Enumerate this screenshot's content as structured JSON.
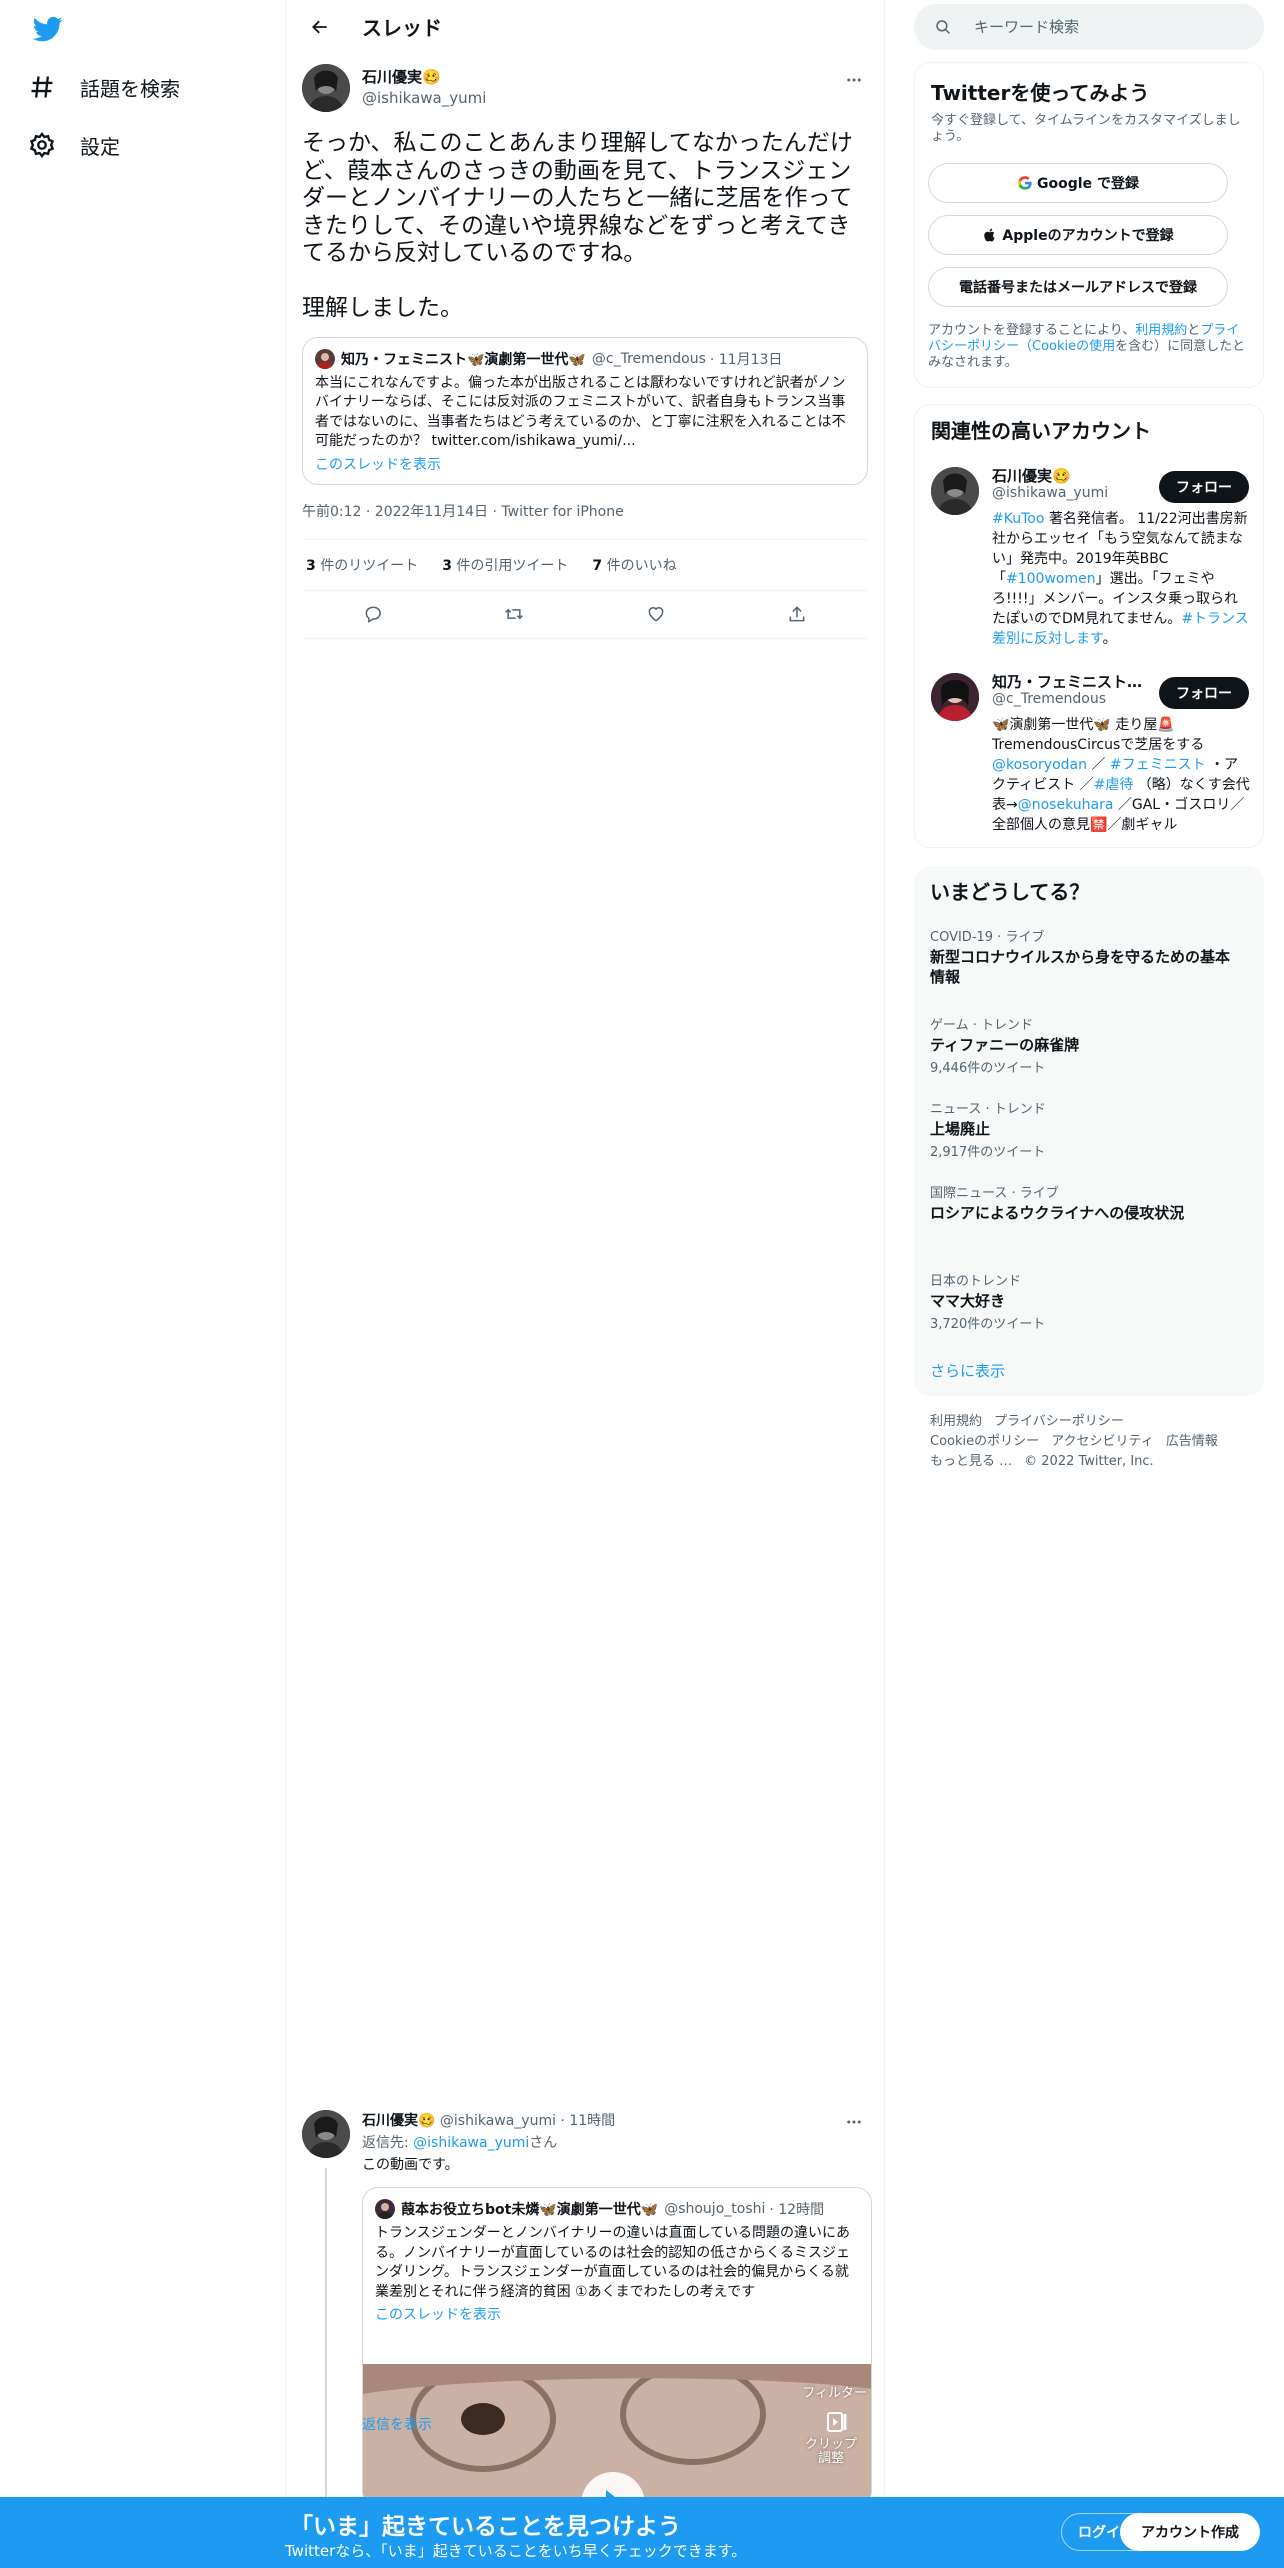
{
  "nav": {
    "explore_label": "話題を検索",
    "settings_label": "設定"
  },
  "header": {
    "title": "スレッド"
  },
  "main_tweet": {
    "author_name": "石川優実🥴",
    "author_handle": "@ishikawa_yumi",
    "text": "そっか、私このことあんまり理解してなかったんだけど、葭本さんのさっきの動画を見て、トランスジェンダーとノンバイナリーの人たちと一緒に芝居を作ってきたりして、その違いや境界線などをずっと考えてきてるから反対しているのですね。\n\n理解しました。",
    "quote": {
      "author_name": "知乃・フェミニスト🦋演劇第一世代🦋",
      "author_handle": "@c_Tremendous",
      "date": "· 11月13日",
      "text": "本当にこれなんですよ。偏った本が出版されることは厭わないですけれど訳者がノンバイナリーならば、そこには反対派のフェミニストがいて、訳者自身もトランス当事者ではないのに、当事者たちはどう考えているのか、と丁寧に注釈を入れることは不可能だったのか？ twitter.com/ishikawa_yumi/...",
      "show_thread": "このスレッドを表示"
    },
    "timestamp": "午前0:12 · 2022年11月14日 · Twitter for iPhone",
    "retweets_count": "3",
    "retweets_label": "件のリツイート",
    "quotes_count": "3",
    "quotes_label": "件の引用ツイート",
    "likes_count": "7",
    "likes_label": "件のいいね"
  },
  "reply_tweet": {
    "author_name": "石川優実🥴",
    "author_handle": "@ishikawa_yumi",
    "time": "· 11時間",
    "reply_to_prefix": "返信先:",
    "reply_to_handle": "@ishikawa_yumi",
    "reply_to_suffix": "さん",
    "text": "この動画です。",
    "quote": {
      "author_name": "葭本お役立ちbot未燐🦋演劇第一世代🦋",
      "author_handle": "@shoujo_toshi",
      "time": "· 12時間",
      "text": "トランスジェンダーとノンバイナリーの違いは直面している問題の違いにある。ノンバイナリーが直面しているのは社会的認知の低さからくるミスジェンダリング。トランスジェンダーが直面しているのは社会的偏見からくる就業差別とそれに伴う経済的貧困 ①あくまでわたしの考えです",
      "show_thread": "このスレッドを表示"
    },
    "video_filter_label": "フィルター",
    "video_clip_label": "クリップ調整",
    "show_replies": "返信を表示"
  },
  "search": {
    "placeholder": "キーワード検索"
  },
  "signup_panel": {
    "title": "Twitterを使ってみよう",
    "subtitle": "今すぐ登録して、タイムラインをカスタマイズしましょう。",
    "google_label": "Google で登録",
    "apple_label": "Appleのアカウントで登録",
    "phone_label": "電話番号またはメールアドレスで登録",
    "terms_prefix": "アカウントを登録することにより、",
    "terms_link": "利用規約",
    "terms_and": "と",
    "privacy_link": "プライバシーポリシー",
    "cookie_prefix": "（",
    "cookie_link": "Cookieの使用",
    "terms_suffix": "を含む）に同意したとみなされます。"
  },
  "relevant": {
    "title": "関連性の高いアカウント",
    "follow_label": "フォロー",
    "accounts": [
      {
        "name": "石川優実🥴",
        "handle": "@ishikawa_yumi",
        "bio_parts": [
          "#KuToo",
          " 著名発信者。 11/22河出書房新社からエッセイ「もう空気なんて読まない」発売中。2019年英BBC 「",
          "#100women",
          "」選出。「フェミやろ!!!!」メンバー。インスタ乗っ取られたぽいのでDM見れてません。",
          "#トランス差別に反対します",
          "。"
        ]
      },
      {
        "name": "知乃・フェミニスト…",
        "handle": "@c_Tremendous",
        "bio_parts": [
          "🦋演劇第一世代🦋 走り屋🚨TremendousCircusで芝居をする",
          "@kosoryodan",
          " ／ ",
          "#フェミニスト",
          " ・アクティビスト ／",
          "#虐待",
          " （略）なくす会代表→",
          "@nosekuhara",
          " ／GAL・ゴスロリ／全部個人の意見🈲／劇ギャル"
        ]
      }
    ]
  },
  "trends": {
    "title": "いまどうしてる？",
    "items": [
      {
        "category": "COVID-19 · ライブ",
        "title": "新型コロナウイルスから身を守るための基本情報",
        "count": ""
      },
      {
        "category": "ゲーム · トレンド",
        "title": "ティファニーの麻雀牌",
        "count": "9,446件のツイート"
      },
      {
        "category": "ニュース · トレンド",
        "title": "上場廃止",
        "count": "2,917件のツイート"
      },
      {
        "category": "国際ニュース · ライブ",
        "title": "ロシアによるウクライナへの侵攻状況",
        "count": ""
      },
      {
        "category": "日本のトレンド",
        "title": "ママ大好き",
        "count": "3,720件のツイート"
      }
    ],
    "show_more": "さらに表示"
  },
  "footer": {
    "terms": "利用規約",
    "privacy": "プライバシーポリシー",
    "cookie": "Cookieのポリシー",
    "accessibility": "アクセシビリティ",
    "ads": "広告情報",
    "more": "もっと見る …",
    "copyright": "© 2022 Twitter, Inc."
  },
  "bottom_bar": {
    "title": "「いま」起きていることを見つけよう",
    "subtitle": "Twitterなら、「いま」起きていることをいち早くチェックできます。",
    "login_label": "ログイン",
    "signup_label": "アカウント作成"
  },
  "colors": {
    "brand_blue": "#1d9bf0",
    "text": "#0f1419",
    "muted": "#536471"
  }
}
